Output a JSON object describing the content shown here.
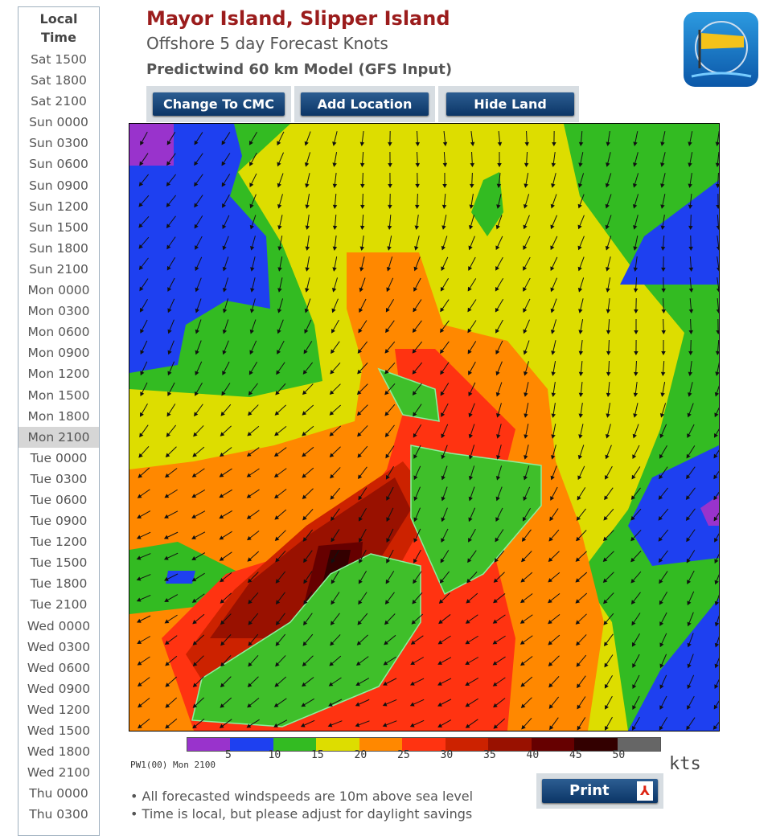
{
  "sidebar": {
    "heading_line1": "Local",
    "heading_line2": "Time",
    "selected": "Mon 2100",
    "items": [
      "Sat 1500",
      "Sat 1800",
      "Sat 2100",
      "Sun 0000",
      "Sun 0300",
      "Sun 0600",
      "Sun 0900",
      "Sun 1200",
      "Sun 1500",
      "Sun 1800",
      "Sun 2100",
      "Mon 0000",
      "Mon 0300",
      "Mon 0600",
      "Mon 0900",
      "Mon 1200",
      "Mon 1500",
      "Mon 1800",
      "Mon 2100",
      "Tue 0000",
      "Tue 0300",
      "Tue 0600",
      "Tue 0900",
      "Tue 1200",
      "Tue 1500",
      "Tue 1800",
      "Tue 2100",
      "Wed 0000",
      "Wed 0300",
      "Wed 0600",
      "Wed 0900",
      "Wed 1200",
      "Wed 1500",
      "Wed 1800",
      "Wed 2100",
      "Thu 0000",
      "Thu 0300"
    ]
  },
  "header": {
    "title": "Mayor Island, Slipper Island",
    "subtitle": "Offshore 5 day Forecast Knots",
    "model": "Predictwind 60 km Model (GFS Input)",
    "logo": "windsock-icon"
  },
  "toolbar": {
    "change_model": "Change To CMC",
    "add_location": "Add Location",
    "hide_land": "Hide Land"
  },
  "legend": {
    "colors": [
      "#9933cc",
      "#1e40f0",
      "#33bb22",
      "#dddd00",
      "#ff8800",
      "#ff3311",
      "#cc2200",
      "#991100",
      "#660000",
      "#330000",
      "#666666"
    ],
    "ticks": [
      "5",
      "10",
      "15",
      "20",
      "25",
      "30",
      "35",
      "40",
      "45",
      "50"
    ],
    "unit": "kts",
    "stamp": "PW1(00) Mon 2100"
  },
  "notes": [
    "All forecasted windspeeds are 10m above sea level",
    "Time is local, but please adjust for daylight savings"
  ],
  "print": {
    "label": "Print",
    "icon": "pdf-icon"
  }
}
